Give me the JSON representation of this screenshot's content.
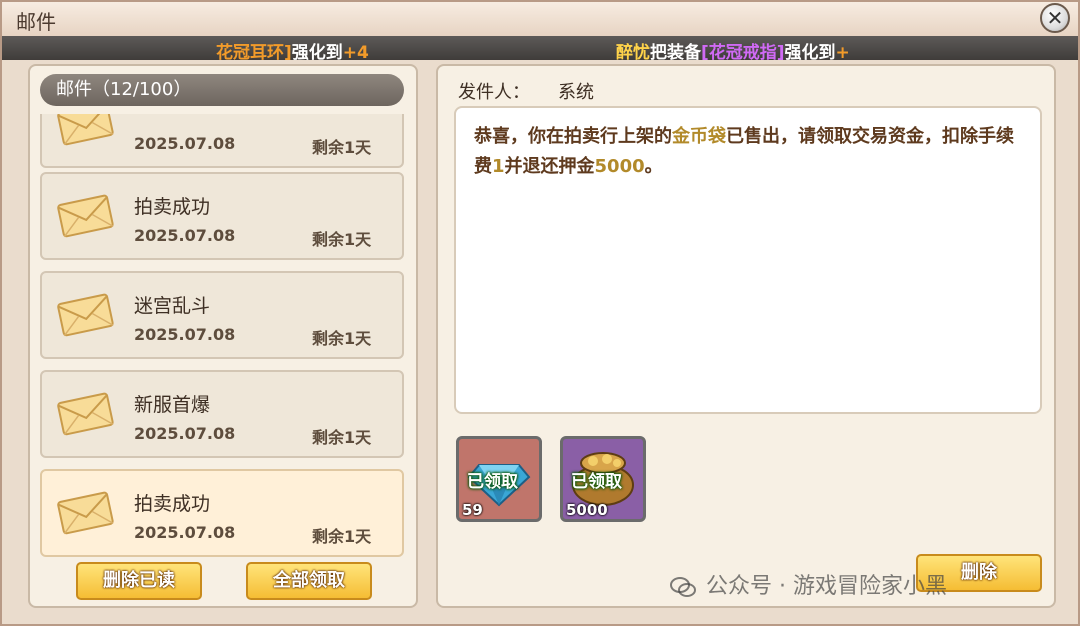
{
  "window": {
    "title": "邮件"
  },
  "ticker": [
    {
      "segments": [
        {
          "text": "花冠耳环]",
          "color": "orange"
        },
        {
          "text": "强化到",
          "color": "white"
        },
        {
          "text": "+4",
          "color": "orange"
        }
      ]
    },
    {
      "segments": [
        {
          "text": "醉忧",
          "color": "gold"
        },
        {
          "text": "把装备",
          "color": "white"
        },
        {
          "text": "[花冠戒指]",
          "color": "purple"
        },
        {
          "text": "强化到",
          "color": "white"
        },
        {
          "text": "+",
          "color": "orange"
        }
      ]
    }
  ],
  "mail_list": {
    "header": "邮件（12/100）",
    "items": [
      {
        "subject": "",
        "date": "2025.07.08",
        "remaining": "剩余1天",
        "selected": false
      },
      {
        "subject": "拍卖成功",
        "date": "2025.07.08",
        "remaining": "剩余1天",
        "selected": false
      },
      {
        "subject": "迷宫乱斗",
        "date": "2025.07.08",
        "remaining": "剩余1天",
        "selected": false
      },
      {
        "subject": "新服首爆",
        "date": "2025.07.08",
        "remaining": "剩余1天",
        "selected": false
      },
      {
        "subject": "拍卖成功",
        "date": "2025.07.08",
        "remaining": "剩余1天",
        "selected": true
      }
    ],
    "delete_read_label": "删除已读",
    "claim_all_label": "全部领取"
  },
  "detail": {
    "sender_label": "发件人：",
    "sender_value": "系统",
    "body_parts": [
      {
        "text": "恭喜，你在拍卖行上架的",
        "hl": false
      },
      {
        "text": "金币袋",
        "hl": true
      },
      {
        "text": "已售出，请领取交易资金，扣除手续费",
        "hl": false
      },
      {
        "text": "1",
        "hl": true
      },
      {
        "text": "并退还押金",
        "hl": false
      },
      {
        "text": "5000",
        "hl": true
      },
      {
        "text": "。",
        "hl": false
      }
    ],
    "rewards": [
      {
        "icon": "gem-icon",
        "status": "已领取",
        "quantity": "59"
      },
      {
        "icon": "gold-bag-icon",
        "status": "已领取",
        "quantity": "5000"
      }
    ],
    "delete_label": "删除"
  },
  "watermark": "公众号 · 游戏冒险家小黑",
  "colors": {
    "highlight": "#b28a2a",
    "button_gold": "#f5bd34",
    "ticker_orange": "#f29b2a",
    "ticker_purple": "#d06af5"
  }
}
